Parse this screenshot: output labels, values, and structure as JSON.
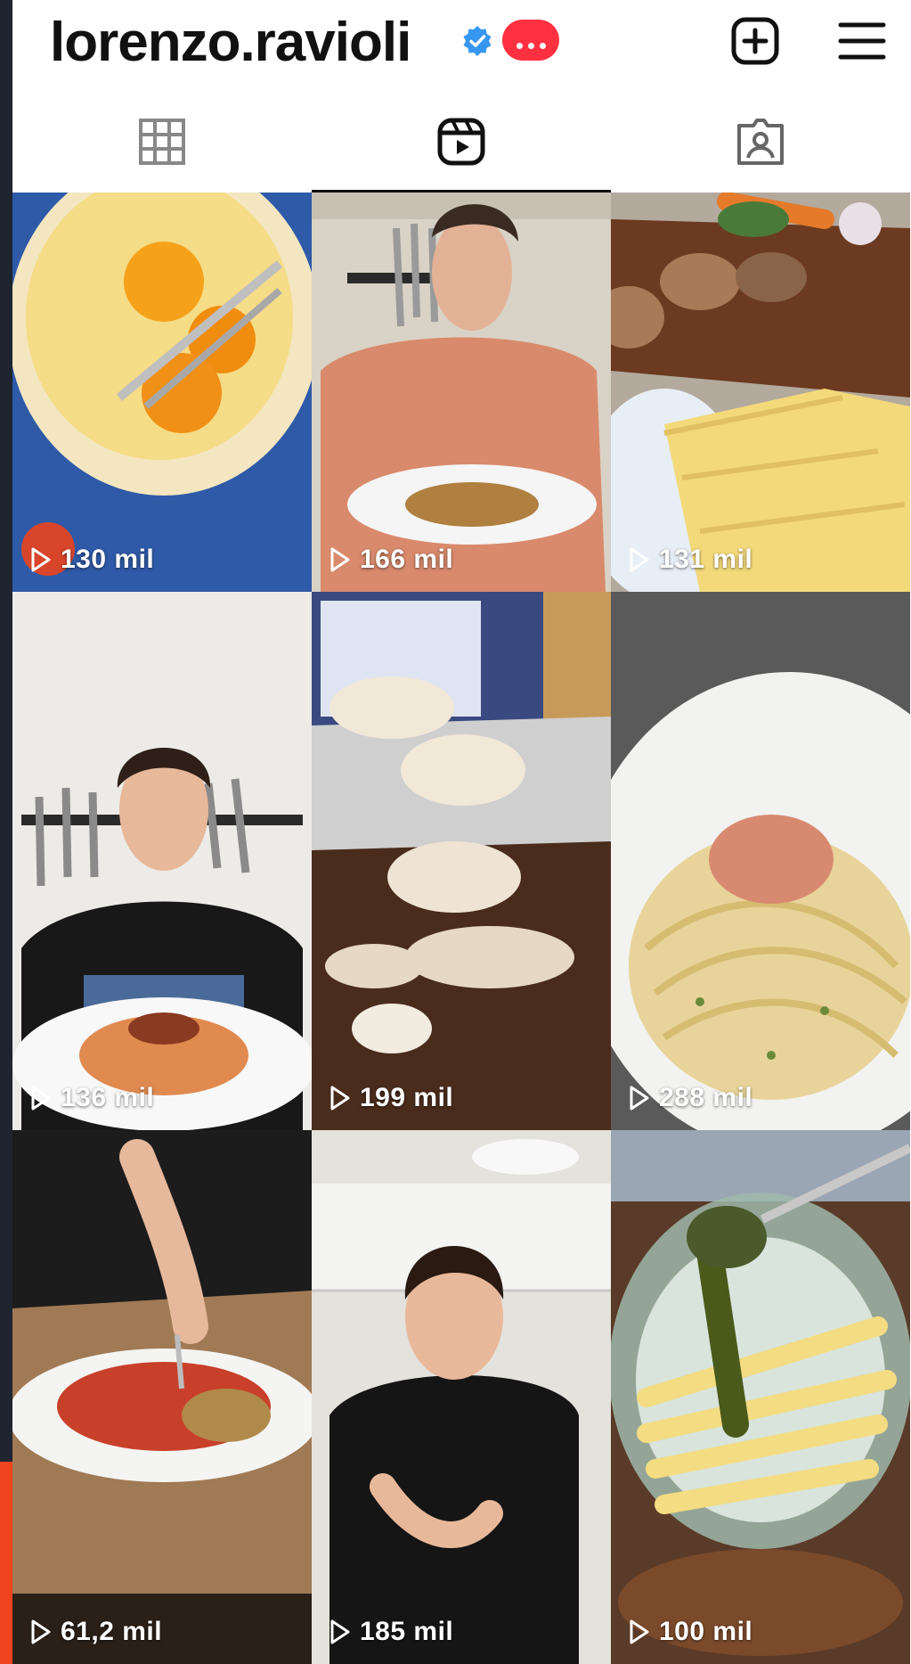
{
  "profile": {
    "username": "lorenzo.ravioli",
    "verified": true,
    "verified_icon": "verified-badge-icon",
    "notification_badge": "ellipsis-badge"
  },
  "header_actions": [
    {
      "name": "create-button",
      "icon": "plus-square-icon"
    },
    {
      "name": "menu-button",
      "icon": "hamburger-menu-icon"
    }
  ],
  "tabs": [
    {
      "name": "tab-posts",
      "icon": "grid-icon",
      "active": false
    },
    {
      "name": "tab-reels",
      "icon": "reels-icon",
      "active": true
    },
    {
      "name": "tab-tagged",
      "icon": "tagged-person-icon",
      "active": false
    }
  ],
  "reels": [
    {
      "views": "130 mil",
      "subject": "raw eggs in a bowl with a fork"
    },
    {
      "views": "166 mil",
      "subject": "man holding a plate of pasta"
    },
    {
      "views": "131 mil",
      "subject": "mushrooms, carrots and cannelloni tubes"
    },
    {
      "views": "136 mil",
      "subject": "smiling man with a plate of shrimp"
    },
    {
      "views": "199 mil",
      "subject": "slicing mushrooms with a knife"
    },
    {
      "views": "288 mil",
      "subject": "spaghetti with pistachio and tartare"
    },
    {
      "views": "61,2 mil",
      "subject": "fork in gnocchi with tomato sauce"
    },
    {
      "views": "185 mil",
      "subject": "man cooking in a kitchen"
    },
    {
      "views": "100 mil",
      "subject": "pesto poured over penne in a glass bowl"
    }
  ],
  "colors": {
    "badge_red": "#ff3040",
    "verified_blue": "#3797f0",
    "frame_dark": "#1e2530",
    "frame_accent": "#f0441e",
    "text_primary": "#111111"
  }
}
